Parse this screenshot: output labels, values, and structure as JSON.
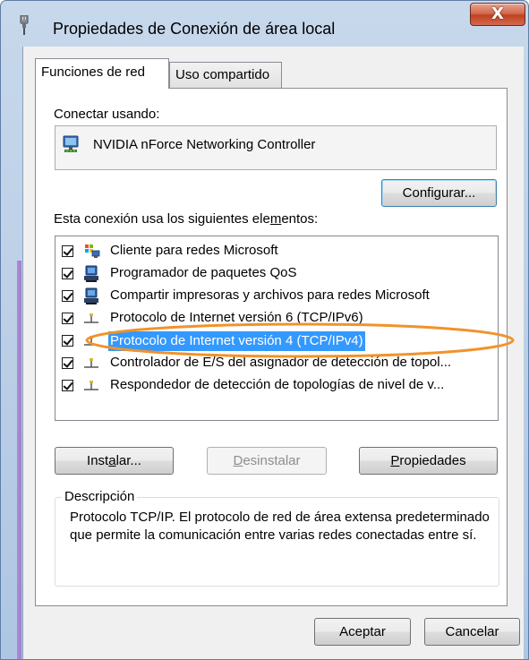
{
  "window": {
    "title": "Propiedades de Conexión de área local",
    "close_label": "X"
  },
  "tabs": [
    {
      "label": "Funciones de red",
      "active": true
    },
    {
      "label": "Uso compartido",
      "active": false
    }
  ],
  "connect_using": {
    "label": "Conectar usando:",
    "adapter": "NVIDIA nForce Networking Controller",
    "configure_button": "Configurar..."
  },
  "components": {
    "label_before": "Esta conexión usa los siguientes ele",
    "label_mnemonic": "m",
    "label_after": "entos:",
    "items": [
      {
        "label": "Cliente para redes Microsoft",
        "checked": true,
        "icon": "network-client-icon",
        "selected": false
      },
      {
        "label": "Programador de paquetes QoS",
        "checked": true,
        "icon": "network-service-icon",
        "selected": false
      },
      {
        "label": "Compartir impresoras y archivos para redes Microsoft",
        "checked": true,
        "icon": "network-service-icon",
        "selected": false
      },
      {
        "label": "Protocolo de Internet versión 6 (TCP/IPv6)",
        "checked": true,
        "icon": "network-protocol-icon",
        "selected": false
      },
      {
        "label": "Protocolo de Internet versión 4 (TCP/IPv4)",
        "checked": true,
        "icon": "network-protocol-icon",
        "selected": true
      },
      {
        "label": "Controlador de E/S del asignador de detección de topol...",
        "checked": true,
        "icon": "network-protocol-icon",
        "selected": false
      },
      {
        "label": "Respondedor de detección de topologías de nivel de v...",
        "checked": true,
        "icon": "network-protocol-icon",
        "selected": false
      }
    ]
  },
  "actions": {
    "install_before": "Inst",
    "install_mnemonic": "a",
    "install_after": "lar...",
    "uninstall_mnemonic": "D",
    "uninstall_after": "esinstalar",
    "properties_mnemonic": "P",
    "properties_after": "ropiedades"
  },
  "description": {
    "title": "Descripción",
    "text": "Protocolo TCP/IP. El protocolo de red de área extensa predeterminado que permite la comunicación entre varias redes conectadas entre sí."
  },
  "footer": {
    "ok": "Aceptar",
    "cancel": "Cancelar"
  },
  "colors": {
    "selection": "#3399ff",
    "annotation_ellipse": "#f0932b",
    "close_button": "#c7432a"
  }
}
